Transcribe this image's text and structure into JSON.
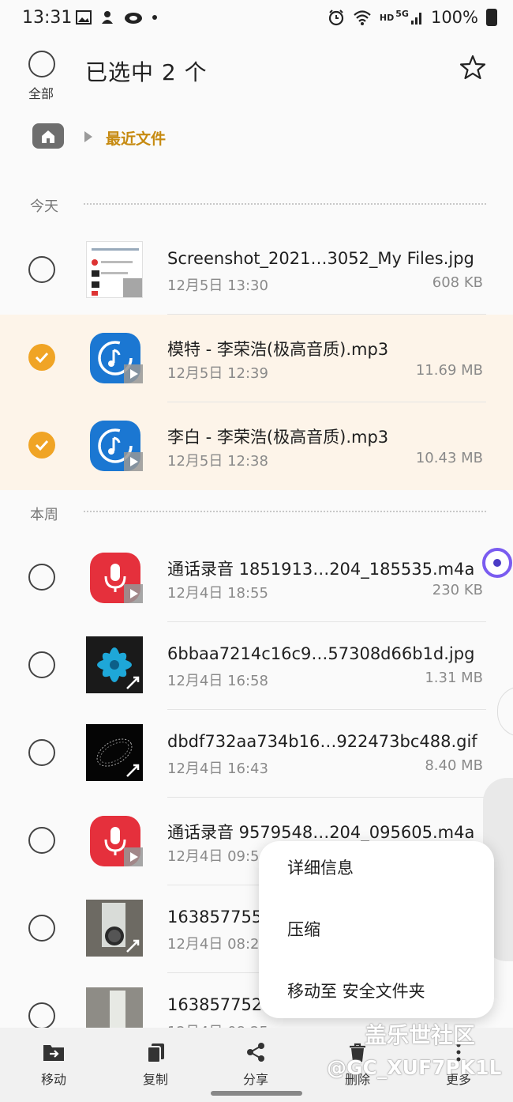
{
  "status_bar": {
    "time": "13:31",
    "battery": "100%",
    "network": "5G",
    "hd": "HD"
  },
  "header": {
    "title": "已选中 2 个",
    "select_all_label": "全部"
  },
  "breadcrumb": {
    "current": "最近文件"
  },
  "sections": {
    "today": "今天",
    "this_week": "本周"
  },
  "files": [
    {
      "name": "Screenshot_2021…3052_My Files.jpg",
      "date": "12月5日 13:30",
      "size": "608 KB",
      "selected": false,
      "kind": "image"
    },
    {
      "name": "模特 - 李荣浩(极高音质).mp3",
      "date": "12月5日 12:39",
      "size": "11.69 MB",
      "selected": true,
      "kind": "music"
    },
    {
      "name": "李白 - 李荣浩(极高音质).mp3",
      "date": "12月5日 12:38",
      "size": "10.43 MB",
      "selected": true,
      "kind": "music"
    },
    {
      "name": "通话录音 1851913…204_185535.m4a",
      "date": "12月4日 18:55",
      "size": "230 KB",
      "selected": false,
      "kind": "recording"
    },
    {
      "name": "6bbaa7214c16c9…57308d66b1d.jpg",
      "date": "12月4日 16:58",
      "size": "1.31 MB",
      "selected": false,
      "kind": "image"
    },
    {
      "name": "dbdf732aa734b16…922473bc488.gif",
      "date": "12月4日 16:43",
      "size": "8.40 MB",
      "selected": false,
      "kind": "image"
    },
    {
      "name": "通话录音 9579548…204_095605.m4a",
      "date": "12月4日 09:5",
      "size": "",
      "selected": false,
      "kind": "recording"
    },
    {
      "name": "163857755",
      "date": "12月4日 08:2",
      "size": "",
      "selected": false,
      "kind": "image"
    },
    {
      "name": "163857752",
      "date": "12月4日 08:25",
      "size": "",
      "selected": false,
      "kind": "image"
    }
  ],
  "context_menu": {
    "items": [
      "详细信息",
      "压缩",
      "移动至 安全文件夹"
    ]
  },
  "bottom_bar": {
    "items": [
      "移动",
      "复制",
      "分享",
      "删除",
      "更多"
    ]
  },
  "watermark": {
    "line1": "盖乐世社区",
    "line2": "@GC_XUF7PK1L"
  },
  "colors": {
    "accent": "#f0a425",
    "selected_row": "#fdf4e9",
    "music_tile": "#1b77d2",
    "record_tile": "#e5303c"
  }
}
